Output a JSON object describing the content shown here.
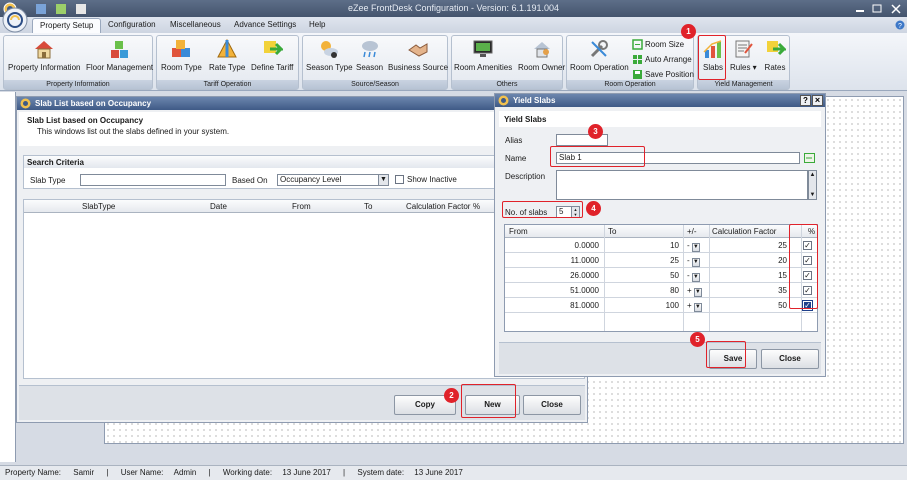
{
  "app": {
    "title": "eZee FrontDesk Configuration - Version: 6.1.191.004"
  },
  "menu": {
    "tabs": [
      "Property Setup",
      "Configuration",
      "Miscellaneous",
      "Advance Settings",
      "Help"
    ]
  },
  "ribbon": {
    "groups": {
      "property_information": "Property Information",
      "tariff_operation": "Tariff Operation",
      "source_season": "Source/Season",
      "others": "Others",
      "room_operation": "Room Operation",
      "yield_management": "Yield Management"
    },
    "buttons": {
      "property_information": "Property Information",
      "floor_management": "Floor Management",
      "room_type": "Room Type",
      "rate_type": "Rate Type",
      "define_tariff": "Define Tariff",
      "season_type": "Season Type",
      "season": "Season",
      "business_source": "Business Source",
      "room_amenities": "Room Amenities",
      "room_owner": "Room Owner",
      "room_operation": "Room Operation",
      "room_size": "Room Size",
      "auto_arrange": "Auto Arrange",
      "save_position": "Save Position",
      "slabs": "Slabs",
      "rules": "Rules",
      "rates": "Rates"
    }
  },
  "slab_list": {
    "window_title": "Slab List based on Occupancy",
    "header_title": "Slab List based on Occupancy",
    "header_desc": "This windows list out the slabs defined in your system.",
    "search_criteria": "Search Criteria",
    "slab_type_label": "Slab Type",
    "slab_type_value": "",
    "based_on_label": "Based On",
    "based_on_value": "Occupancy Level",
    "show_inactive": "Show Inactive",
    "columns": [
      "SlabType",
      "Date",
      "From",
      "To",
      "Calculation Factor",
      "%"
    ],
    "buttons": {
      "copy": "Copy",
      "new": "New",
      "close": "Close"
    }
  },
  "yield_slabs": {
    "window_title": "Yield Slabs",
    "help_btn": "?",
    "close_btn": "×",
    "section_title": "Yield Slabs",
    "alias_label": "Alias",
    "alias_value": "",
    "name_label": "Name",
    "name_value": "Slab 1",
    "description_label": "Description",
    "description_value": "",
    "no_of_slabs_label": "No. of slabs",
    "no_of_slabs_value": "5",
    "columns": [
      "From",
      "To",
      "+/-",
      "Calculation Factor",
      "%"
    ],
    "rows": [
      {
        "from": "0.0000",
        "to": "10",
        "sign": "-",
        "factor": "25",
        "pct": true
      },
      {
        "from": "11.0000",
        "to": "25",
        "sign": "-",
        "factor": "20",
        "pct": true
      },
      {
        "from": "26.0000",
        "to": "50",
        "sign": "-",
        "factor": "15",
        "pct": true
      },
      {
        "from": "51.0000",
        "to": "80",
        "sign": "+",
        "factor": "35",
        "pct": true
      },
      {
        "from": "81.0000",
        "to": "100",
        "sign": "+",
        "factor": "50",
        "pct": true
      }
    ],
    "buttons": {
      "save": "Save",
      "close": "Close"
    }
  },
  "annotations": [
    "1",
    "2",
    "3",
    "4",
    "5"
  ],
  "status": {
    "property_label": "Property Name:",
    "property_value": "Samir",
    "user_label": "User Name:",
    "user_value": "Admin",
    "working_label": "Working date:",
    "working_value": "13 June 2017",
    "system_label": "System date:",
    "system_value": "13 June 2017"
  },
  "colors": {
    "highlight": "#e0222a",
    "title_blue": "#3f5a86"
  }
}
